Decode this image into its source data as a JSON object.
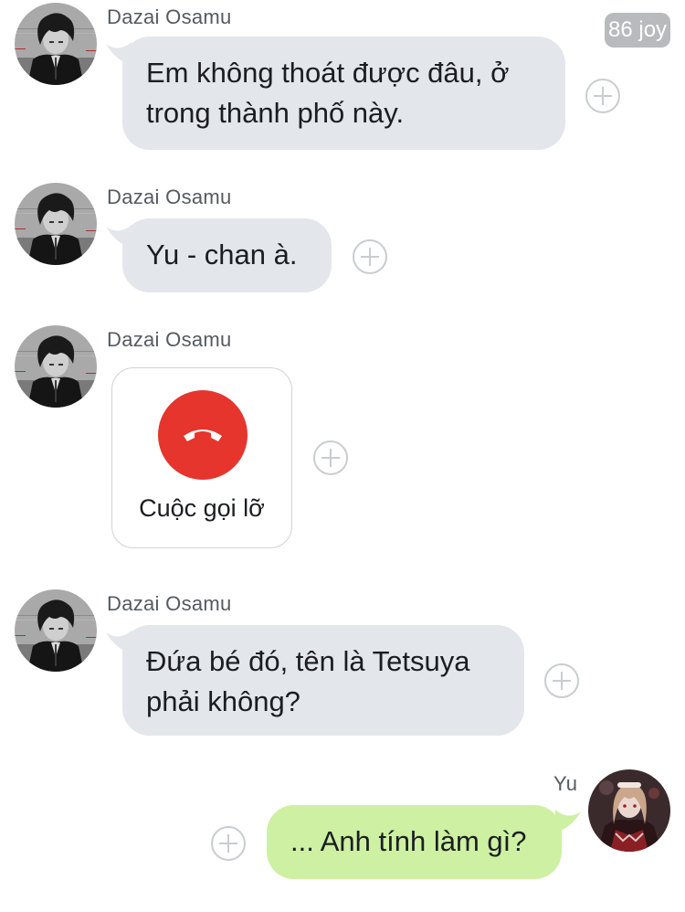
{
  "status_badge": "86 joy",
  "messages": [
    {
      "sender": "Dazai Osamu",
      "avatar_icon": "dazai-avatar",
      "lines": [
        "Em không thoát được đâu, ở",
        "trong thành phố này."
      ]
    },
    {
      "sender": "Dazai Osamu",
      "avatar_icon": "dazai-avatar",
      "lines": [
        "Yu - chan à."
      ]
    },
    {
      "sender": "Dazai Osamu",
      "avatar_icon": "dazai-avatar",
      "call": {
        "icon": "phone-hangup-icon",
        "label": "Cuộc gọi lỡ",
        "accent": "#e5352c"
      }
    },
    {
      "sender": "Dazai Osamu",
      "avatar_icon": "dazai-avatar",
      "lines": [
        "Đứa bé đó, tên là Tetsuya",
        "phải không?"
      ]
    },
    {
      "sender": "Yu",
      "avatar_icon": "yu-avatar",
      "outgoing": true,
      "lines": [
        "... Anh tính làm gì?"
      ]
    }
  ],
  "colors": {
    "incoming_bubble": "#e3e6ea",
    "outgoing_bubble": "#cdf0a2",
    "missed_call": "#e5352c"
  }
}
